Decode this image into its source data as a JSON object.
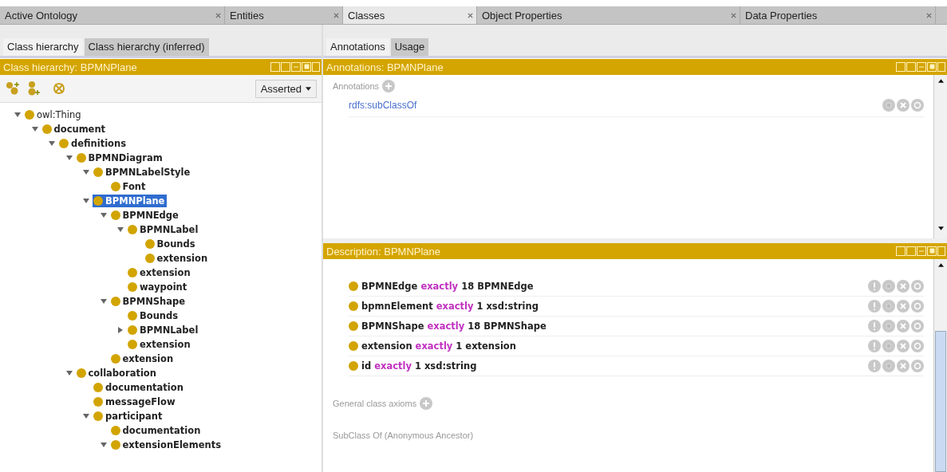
{
  "tabs": [
    {
      "label": "Active Ontology",
      "selected": false
    },
    {
      "label": "Entities",
      "selected": false
    },
    {
      "label": "Classes",
      "selected": true
    },
    {
      "label": "Object Properties",
      "selected": false
    },
    {
      "label": "Data Properties",
      "selected": false
    }
  ],
  "left": {
    "tabs": [
      {
        "label": "Class hierarchy",
        "selected": true
      },
      {
        "label": "Class hierarchy (inferred)",
        "selected": false
      }
    ],
    "header": "Class hierarchy: BPMNPlane",
    "dropdown": "Asserted",
    "tree": [
      {
        "label": "owl:Thing",
        "kind": "branch",
        "expanded": true,
        "selected": false,
        "children": [
          {
            "label": "document",
            "kind": "branch",
            "expanded": true,
            "selected": false,
            "children": [
              {
                "label": "definitions",
                "kind": "branch",
                "expanded": true,
                "selected": false,
                "children": [
                  {
                    "label": "BPMNDiagram",
                    "kind": "branch",
                    "expanded": true,
                    "selected": false,
                    "children": [
                      {
                        "label": "BPMNLabelStyle",
                        "kind": "branch",
                        "expanded": true,
                        "selected": false,
                        "children": [
                          {
                            "label": "Font",
                            "kind": "leaf",
                            "selected": false
                          }
                        ]
                      },
                      {
                        "label": "BPMNPlane",
                        "kind": "branch",
                        "expanded": true,
                        "selected": true,
                        "children": [
                          {
                            "label": "BPMNEdge",
                            "kind": "branch",
                            "expanded": true,
                            "selected": false,
                            "children": [
                              {
                                "label": "BPMNLabel",
                                "kind": "branch",
                                "expanded": true,
                                "selected": false,
                                "children": [
                                  {
                                    "label": "Bounds",
                                    "kind": "leaf",
                                    "selected": false
                                  },
                                  {
                                    "label": "extension",
                                    "kind": "leaf",
                                    "selected": false
                                  }
                                ]
                              },
                              {
                                "label": "extension",
                                "kind": "leaf",
                                "selected": false
                              },
                              {
                                "label": "waypoint",
                                "kind": "leaf",
                                "selected": false
                              }
                            ]
                          },
                          {
                            "label": "BPMNShape",
                            "kind": "branch",
                            "expanded": true,
                            "selected": false,
                            "children": [
                              {
                                "label": "Bounds",
                                "kind": "leaf",
                                "selected": false
                              },
                              {
                                "label": "BPMNLabel",
                                "kind": "branch",
                                "expanded": false,
                                "selected": false
                              },
                              {
                                "label": "extension",
                                "kind": "leaf",
                                "selected": false
                              }
                            ]
                          },
                          {
                            "label": "extension",
                            "kind": "leaf",
                            "selected": false
                          }
                        ]
                      }
                    ]
                  },
                  {
                    "label": "collaboration",
                    "kind": "branch",
                    "expanded": true,
                    "selected": false,
                    "children": [
                      {
                        "label": "documentation",
                        "kind": "leaf",
                        "selected": false
                      },
                      {
                        "label": "messageFlow",
                        "kind": "leaf",
                        "selected": false
                      },
                      {
                        "label": "participant",
                        "kind": "branch",
                        "expanded": true,
                        "selected": false,
                        "children": [
                          {
                            "label": "documentation",
                            "kind": "leaf",
                            "selected": false
                          },
                          {
                            "label": "extensionElements",
                            "kind": "branch",
                            "expanded": true,
                            "selected": false
                          }
                        ]
                      }
                    ]
                  }
                ]
              }
            ]
          }
        ]
      }
    ]
  },
  "right": {
    "tabs": [
      {
        "label": "Annotations",
        "selected": true
      },
      {
        "label": "Usage",
        "selected": false
      }
    ],
    "annotations": {
      "header": "Annotations: BPMNPlane",
      "section_label": "Annotations",
      "items": [
        "rdfs:subClassOf"
      ]
    },
    "description": {
      "header": "Description: BPMNPlane",
      "rows": [
        {
          "property": "BPMNEdge",
          "restriction": "exactly",
          "filler": "18 BPMNEdge"
        },
        {
          "property": "bpmnElement",
          "restriction": "exactly",
          "filler": "1 xsd:string"
        },
        {
          "property": "BPMNShape",
          "restriction": "exactly",
          "filler": "18 BPMNShape"
        },
        {
          "property": "extension",
          "restriction": "exactly",
          "filler": "1 extension"
        },
        {
          "property": "id",
          "restriction": "exactly",
          "filler": "1 xsd:string"
        }
      ],
      "sections": [
        {
          "label": "General class axioms",
          "addable": true
        },
        {
          "label": "SubClass Of (Anonymous Ancestor)",
          "addable": false
        }
      ]
    }
  }
}
